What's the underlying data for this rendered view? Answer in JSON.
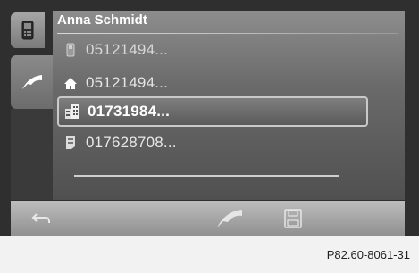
{
  "contact": {
    "name": "Anna Schmidt",
    "numbers": [
      {
        "type": "mobile-icon",
        "number": "05121494..."
      },
      {
        "type": "home-icon",
        "number": "05121494..."
      },
      {
        "type": "office-building-icon",
        "number": "01731984...",
        "selected": true
      },
      {
        "type": "business-phone-icon",
        "number": "017628708..."
      }
    ]
  },
  "toolbar": {
    "back_icon": "back-arrow-icon",
    "call_icon": "handset-icon",
    "save_icon": "save-disk-icon"
  },
  "sidebar": {
    "tabs": [
      {
        "icon": "mobile-phone-icon"
      },
      {
        "icon": "handset-icon"
      }
    ]
  },
  "caption": "P82.60-8061-31",
  "colors": {
    "frame": "#2f2f2f",
    "text": "#ffffff",
    "selection_border": "#c9c9c9"
  }
}
